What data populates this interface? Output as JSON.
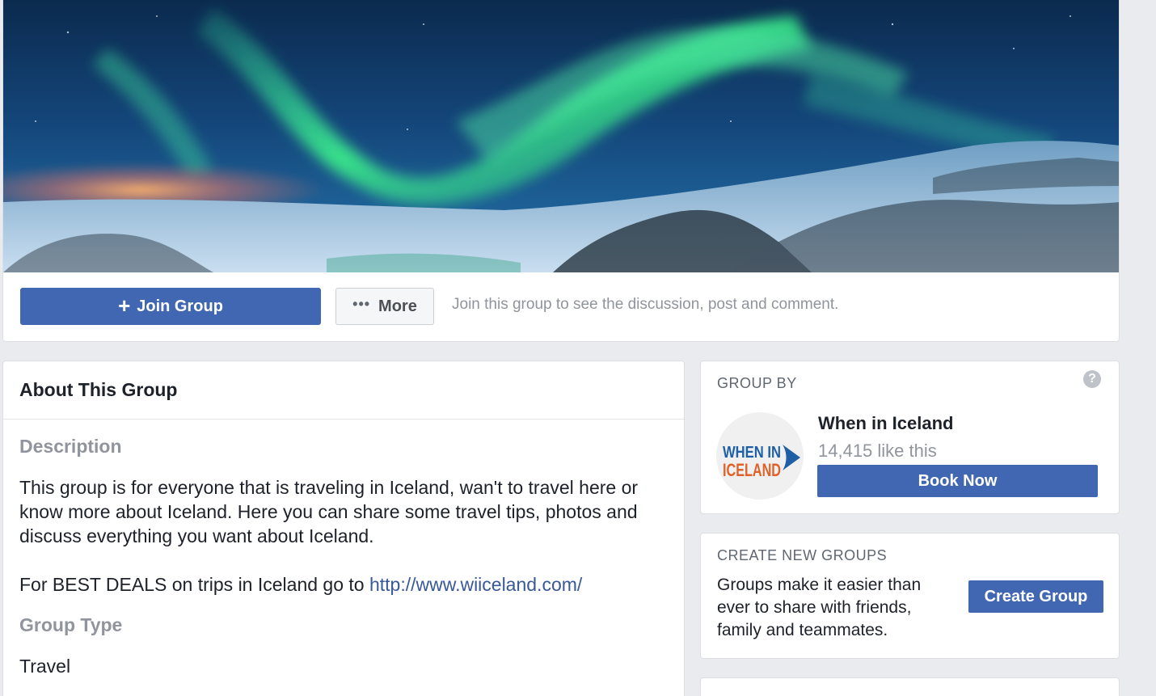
{
  "actions": {
    "join_label": "Join Group",
    "join_icon": "+",
    "more_label": "More",
    "more_icon": "•••",
    "join_hint": "Join this group to see the discussion, post and comment."
  },
  "about": {
    "title": "About This Group",
    "description_label": "Description",
    "description": "This group is for everyone that is traveling in Iceland, wan't to travel here or know more about Iceland. Here you can share some travel tips, photos and discuss everything you want about Iceland.",
    "deals_prefix": "For BEST DEALS on trips in Iceland go to ",
    "deals_link": "http://www.wiiceland.com/",
    "group_type_label": "Group Type",
    "group_type": "Travel"
  },
  "group_by": {
    "title": "GROUP BY",
    "help_icon": "?",
    "page_name": "When in Iceland",
    "likes": "14,415 like this",
    "book_label": "Book Now",
    "logo_line1": "WHEN IN",
    "logo_line2": "ICELAND"
  },
  "create_groups": {
    "title": "CREATE NEW GROUPS",
    "text": "Groups make it easier than ever to share with friends, family and teammates.",
    "button_label": "Create Group"
  },
  "colors": {
    "primary": "#4267b2",
    "link": "#385898",
    "muted": "#90949c",
    "text": "#1d2129",
    "background": "#e9ebee"
  }
}
